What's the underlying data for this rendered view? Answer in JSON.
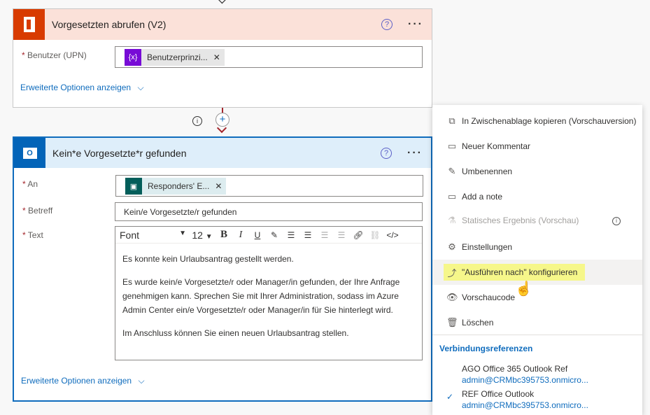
{
  "card1": {
    "title": "Vorgesetzten abrufen (V2)",
    "field_label": "Benutzer (UPN)",
    "token": "Benutzerprinzi...",
    "advanced": "Erweiterte Optionen anzeigen",
    "color": "#d83b01"
  },
  "card2": {
    "title": "Kein*e Vorgesetzte*r gefunden",
    "to_label": "An",
    "to_token": "Responders' E...",
    "subject_label": "Betreff",
    "subject_value": "Kein/e Vorgesetzte/r gefunden",
    "text_label": "Text",
    "toolbar": {
      "font": "Font",
      "size": "12"
    },
    "body": [
      "Es konnte kein Urlaubsantrag gestellt werden.",
      "Es wurde kein/e Vorgesetzte/r oder Manager/in gefunden, der Ihre Anfrage genehmigen kann. Sprechen Sie mit Ihrer Administration, sodass im Azure Admin Center ein/e Vorgesetzte/r oder Manager/in für Sie hinterlegt wird.",
      "Im Anschluss können Sie einen neuen Urlaubsantrag stellen."
    ],
    "advanced": "Erweiterte Optionen anzeigen",
    "color": "#0f6cbd"
  },
  "menu": {
    "items": [
      {
        "label": "In Zwischenablage kopieren (Vorschauversion)",
        "icon": "copy-icon"
      },
      {
        "label": "Neuer Kommentar",
        "icon": "comment-icon"
      },
      {
        "label": "Umbenennen",
        "icon": "pencil-icon"
      },
      {
        "label": "Add a note",
        "icon": "note-icon"
      },
      {
        "label": "Statisches Ergebnis (Vorschau)",
        "icon": "flask-icon",
        "disabled": true
      },
      {
        "label": "Einstellungen",
        "icon": "gear-icon"
      },
      {
        "label": "\"Ausführen nach\" konfigurieren",
        "icon": "run-after-icon",
        "highlighted": true
      },
      {
        "label": "Vorschaucode",
        "icon": "eye-icon"
      },
      {
        "label": "Löschen",
        "icon": "trash-icon"
      }
    ],
    "section": "Verbindungsreferenzen",
    "connections": [
      {
        "name": "AGO Office 365 Outlook Ref",
        "account": "admin@CRMbc395753.onmicro..."
      },
      {
        "name": "REF Office Outlook",
        "account": "admin@CRMbc395753.onmicro...",
        "selected": true
      }
    ]
  }
}
